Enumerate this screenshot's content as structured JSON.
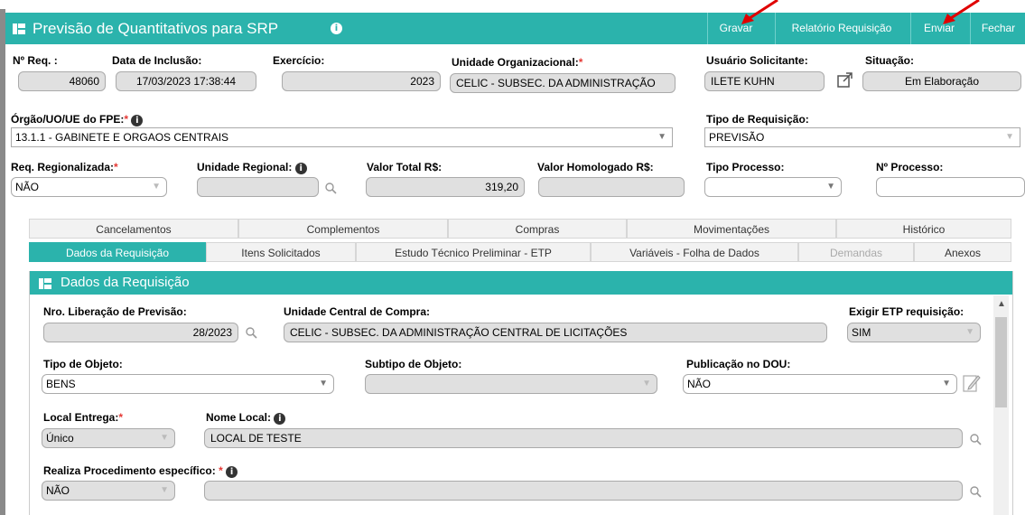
{
  "window": {
    "title": "Previsão de Quantitativos para SRP",
    "buttons": {
      "gravar": "Gravar",
      "relatorio": "Relatório Requisição",
      "enviar": "Enviar",
      "fechar": "Fechar"
    }
  },
  "header": {
    "nreq_label": "Nº Req. :",
    "nreq_value": "48060",
    "data_inclusao_label": "Data de Inclusão:",
    "data_inclusao_value": "17/03/2023 17:38:44",
    "exercicio_label": "Exercício:",
    "exercicio_value": "2023",
    "unidade_org_label": "Unidade Organizacional:",
    "unidade_org_value": "CELIC - SUBSEC. DA ADMINISTRAÇÃO",
    "usuario_label": "Usuário Solicitante:",
    "usuario_value": "ILETE KUHN",
    "situacao_label": "Situação:",
    "situacao_value": "Em Elaboração",
    "orgao_label": "Órgão/UO/UE do FPE:",
    "orgao_value": "13.1.1 - GABINETE E ORGAOS CENTRAIS",
    "tipo_req_label": "Tipo de Requisição:",
    "tipo_req_value": "PREVISÃO",
    "req_regional_label": "Req. Regionalizada:",
    "req_regional_value": "NÃO",
    "unidade_regional_label": "Unidade Regional:",
    "unidade_regional_value": "",
    "valor_total_label": "Valor Total R$:",
    "valor_total_value": "319,20",
    "valor_homologado_label": "Valor Homologado R$:",
    "valor_homologado_value": "",
    "tipo_processo_label": "Tipo Processo:",
    "tipo_processo_value": "",
    "nprocesso_label": "Nº Processo:",
    "nprocesso_value": ""
  },
  "tabs_row1": [
    "Cancelamentos",
    "Complementos",
    "Compras",
    "Movimentações",
    "Histórico"
  ],
  "tabs_row2": [
    "Dados da Requisição",
    "Itens Solicitados",
    "Estudo Técnico Preliminar - ETP",
    "Variáveis - Folha de Dados",
    "Demandas",
    "Anexos"
  ],
  "section": {
    "title": "Dados da Requisição",
    "nro_lib_label": "Nro. Liberação de Previsão:",
    "nro_lib_value": "28/2023",
    "unidade_central_label": "Unidade Central de Compra:",
    "unidade_central_value": "CELIC - SUBSEC. DA ADMINISTRAÇÃO CENTRAL DE LICITAÇÕES",
    "exigir_etp_label": "Exigir ETP requisição:",
    "exigir_etp_value": "SIM",
    "tipo_objeto_label": "Tipo de Objeto:",
    "tipo_objeto_value": "BENS",
    "subtipo_objeto_label": "Subtipo de Objeto:",
    "subtipo_objeto_value": "",
    "publicacao_dou_label": "Publicação no DOU:",
    "publicacao_dou_value": "NÃO",
    "local_entrega_label": "Local Entrega:",
    "local_entrega_value": "Único",
    "nome_local_label": "Nome Local:",
    "nome_local_value": "LOCAL DE TESTE",
    "realiza_proc_label": "Realiza Procedimento específico:",
    "realiza_proc_value": "NÃO",
    "realiza_proc_text": ""
  },
  "colors": {
    "accent": "#2bb3ac",
    "required": "#e53935",
    "arrow": "#e00000"
  }
}
